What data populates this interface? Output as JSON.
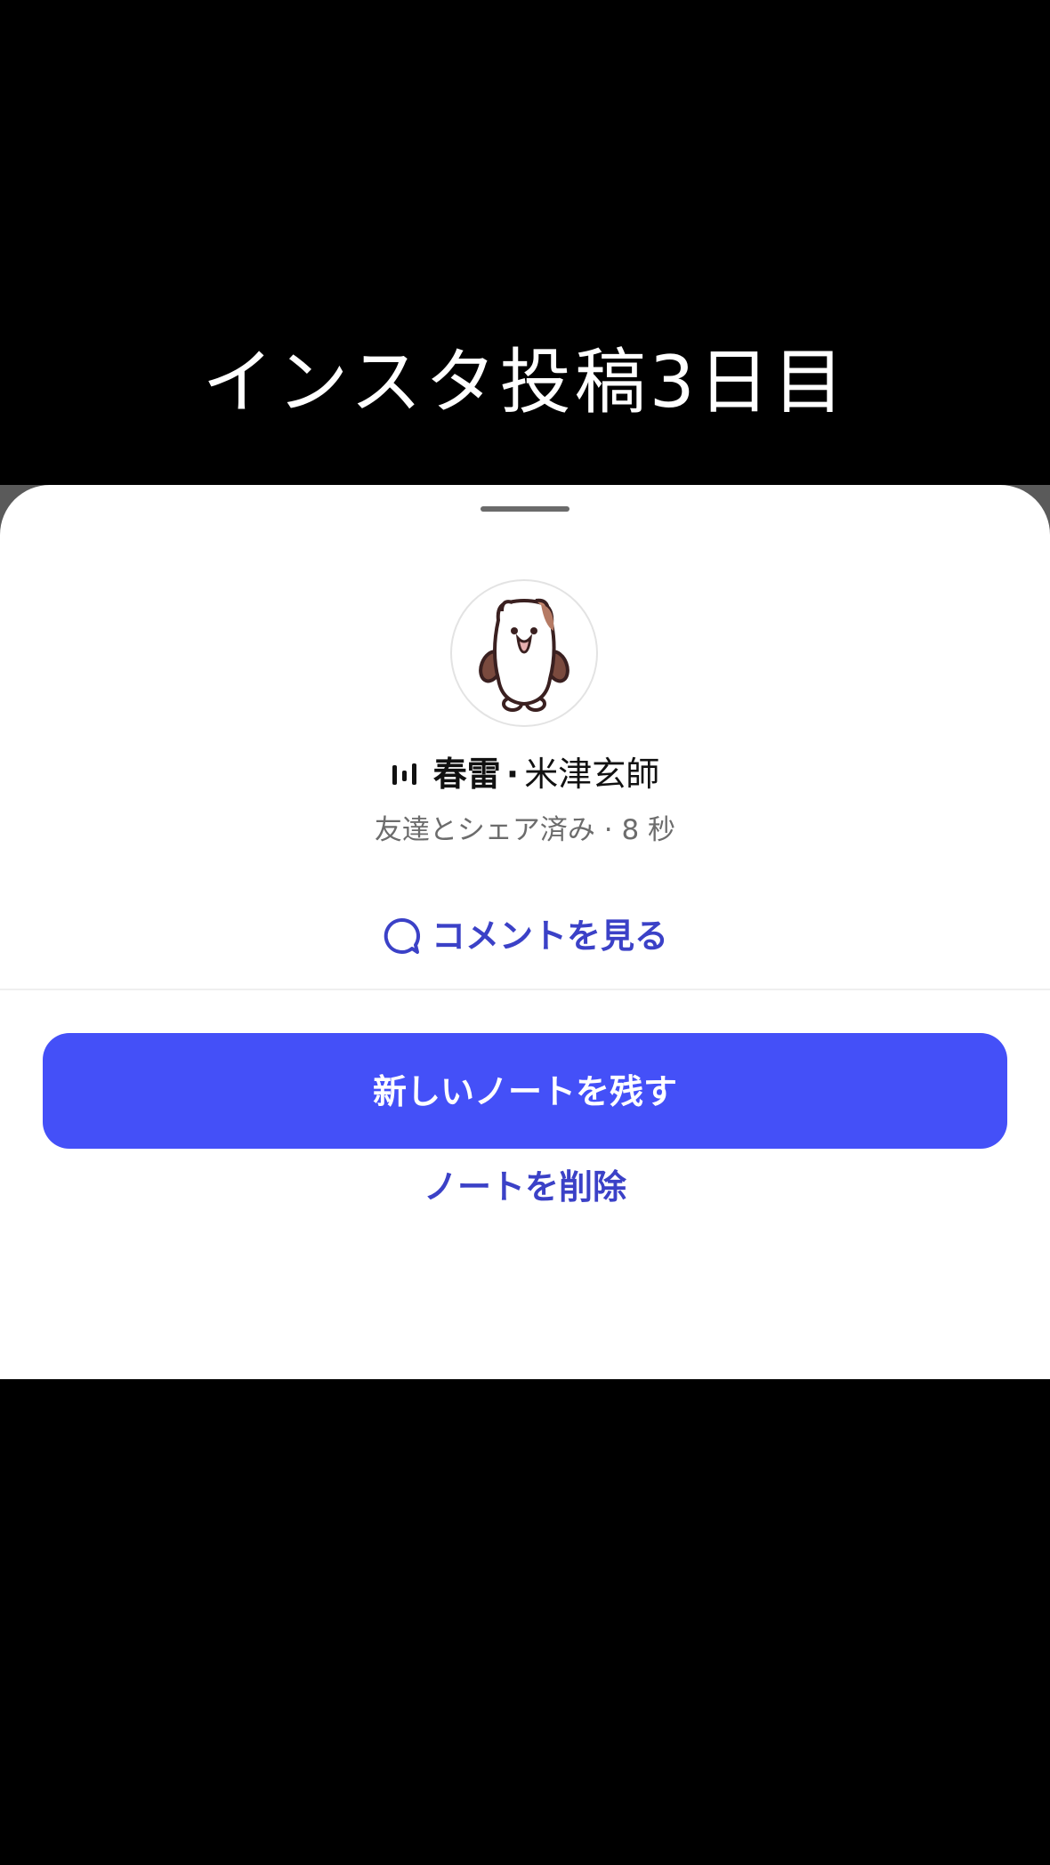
{
  "caption": "インスタ投稿3日目",
  "sheet": {
    "music": {
      "icon": "equalizer-icon",
      "song": "春雷",
      "separator": "·",
      "artist": "米津玄師"
    },
    "meta": "友達とシェア済み · 8 秒",
    "comments_link": {
      "icon": "comment-bubble-icon",
      "label": "コメントを見る"
    },
    "primary_button": "新しいノートを残す",
    "delete_link": "ノートを削除"
  },
  "colors": {
    "accent_button": "#4450f8",
    "link_text": "#3b41c7",
    "meta_text": "#6c6c6c",
    "background": "#000000",
    "sheet": "#ffffff"
  }
}
